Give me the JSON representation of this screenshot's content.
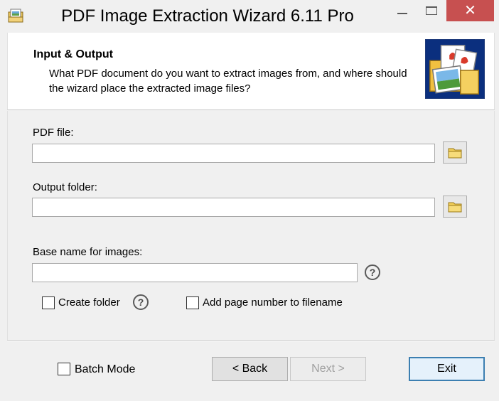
{
  "window": {
    "title": "PDF Image Extraction Wizard 6.11 Pro",
    "close_glyph": "✕",
    "icon": "app-icon"
  },
  "header": {
    "title": "Input & Output",
    "description": "What PDF document do you want to extract images from, and where should the wizard place the extracted image files?"
  },
  "form": {
    "pdf_file_label": "PDF file:",
    "pdf_file_value": "",
    "output_folder_label": "Output folder:",
    "output_folder_value": "",
    "base_name_label": "Base name for images:",
    "base_name_value": "",
    "help_glyph": "?",
    "create_folder_label": "Create folder",
    "create_folder_checked": false,
    "add_page_number_label": "Add page number to filename",
    "add_page_number_checked": false
  },
  "footer": {
    "batch_mode_label": "Batch Mode",
    "batch_mode_checked": false,
    "back_label": "< Back",
    "next_label": "Next >",
    "exit_label": "Exit"
  },
  "colors": {
    "close_button": "#c75050",
    "default_button_border": "#3c7fb1",
    "window_bg": "#f0f0f0"
  }
}
